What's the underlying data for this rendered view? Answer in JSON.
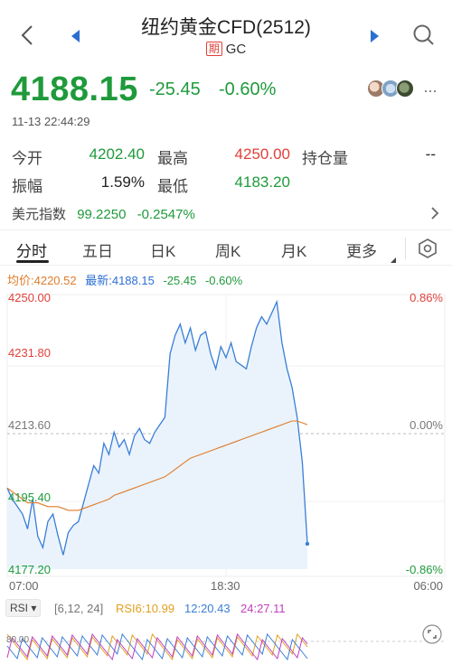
{
  "header": {
    "title": "纽约黄金CFD(2512)",
    "badge": "期",
    "code": "GC"
  },
  "quote": {
    "price": "4188.15",
    "change": "-25.45",
    "change_pct": "-0.60%",
    "timestamp": "11-13 22:44:29"
  },
  "stats": {
    "open_label": "今开",
    "open_value": "4202.40",
    "high_label": "最高",
    "high_value": "4250.00",
    "oi_label": "持仓量",
    "oi_value": "--",
    "amp_label": "振幅",
    "amp_value": "1.59%",
    "low_label": "最低",
    "low_value": "4183.20"
  },
  "index_row": {
    "label": "美元指数",
    "value": "99.2250",
    "change": "-0.2547%"
  },
  "tabs": [
    {
      "label": "分时"
    },
    {
      "label": "五日"
    },
    {
      "label": "日K"
    },
    {
      "label": "周K"
    },
    {
      "label": "月K"
    },
    {
      "label": "更多"
    }
  ],
  "chart_legend": {
    "avg_label": "均价:4220.52",
    "latest_label": "最新:4188.15",
    "change": "-25.45",
    "change_pct": "-0.60%"
  },
  "colors": {
    "up": "#e0403a",
    "down": "#1f9a3b",
    "price_line": "#3a7fd6",
    "avg_line": "#e07b29",
    "area_fill": "#eaf3fc"
  },
  "chart_data": {
    "type": "line",
    "title": "",
    "y_ticks_left": [
      "4250.00",
      "4231.80",
      "4213.60",
      "4195.40",
      "4177.20"
    ],
    "y_ticks_right": [
      "0.86%",
      "0.00%",
      "-0.86%"
    ],
    "x_ticks": [
      "07:00",
      "18:30",
      "06:00"
    ],
    "ylim": [
      4177.2,
      4250.0
    ],
    "prev_close": 4213.6,
    "series": [
      {
        "name": "最新",
        "values": [
          4199,
          4196,
          4194,
          4192,
          4188,
          4196,
          4186,
          4183,
          4190,
          4192,
          4186,
          4181,
          4187,
          4189,
          4190,
          4195,
          4200,
          4205,
          4203,
          4211,
          4208,
          4214,
          4210,
          4212,
          4208,
          4213,
          4215,
          4212,
          4211,
          4214,
          4216,
          4218,
          4235,
          4240,
          4243,
          4238,
          4242,
          4236,
          4240,
          4241,
          4235,
          4231,
          4237,
          4234,
          4238,
          4233,
          4232,
          4231,
          4237,
          4242,
          4245,
          4243,
          4246,
          4249,
          4238,
          4231,
          4226,
          4218,
          4206,
          4184
        ]
      },
      {
        "name": "均价",
        "values": [
          4199,
          4198,
          4197,
          4196,
          4195,
          4195,
          4195,
          4194.5,
          4194,
          4194,
          4194,
          4193.5,
          4193,
          4193,
          4193,
          4193.5,
          4194,
          4194.5,
          4195,
          4195.5,
          4196,
          4197,
          4197.5,
          4198,
          4198.5,
          4199,
          4199.5,
          4200,
          4200.5,
          4201,
          4201.5,
          4202,
          4203,
          4204,
          4205,
          4206,
          4207,
          4207.5,
          4208,
          4208.5,
          4209,
          4209.5,
          4210,
          4210.5,
          4211,
          4211.5,
          4212,
          4212.5,
          4213,
          4213.5,
          4214,
          4214.5,
          4215,
          4215.5,
          4216,
          4216.5,
          4217,
          4217,
          4216.5,
          4216
        ]
      }
    ]
  },
  "rsi": {
    "selector": "RSI",
    "params": "[6,12, 24]",
    "rsi6": "RSI6:10.99",
    "rsi12": "12:20.43",
    "rsi24": "24:27.11",
    "level": "80.00"
  }
}
